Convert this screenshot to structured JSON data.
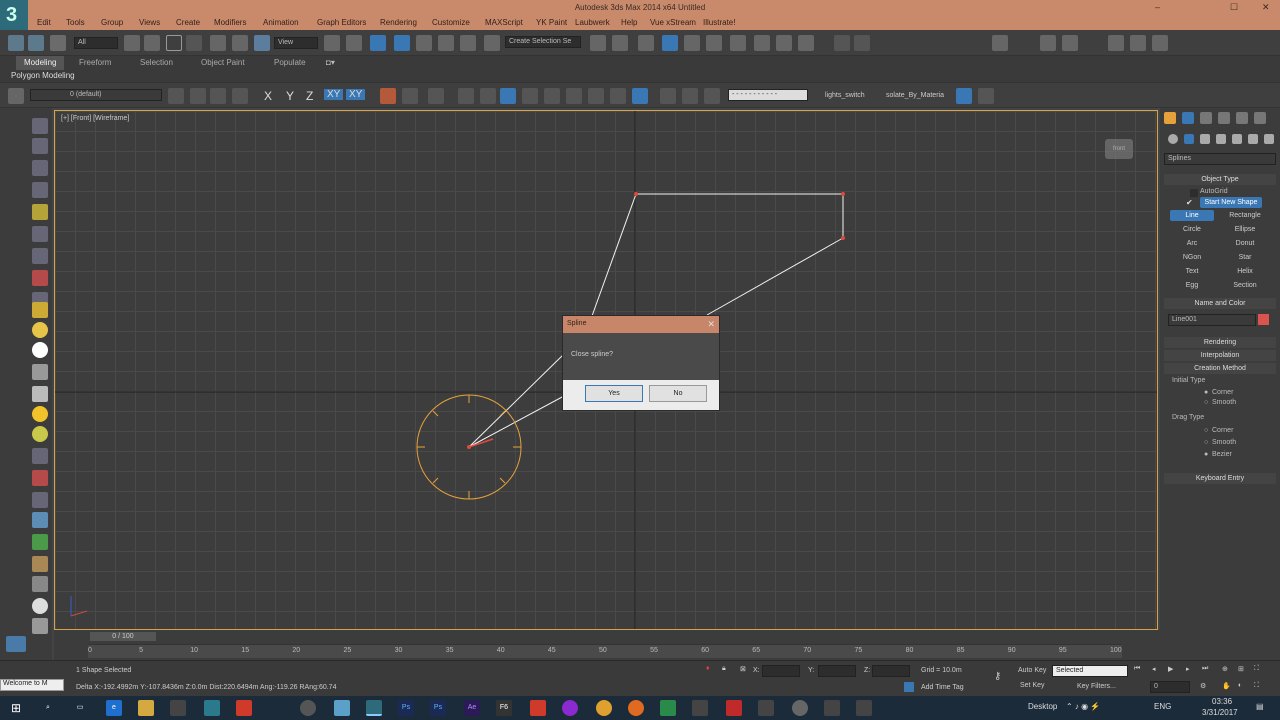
{
  "app": {
    "title": "Autodesk 3ds Max 2014 x64      Untitled"
  },
  "menu": [
    "Edit",
    "Tools",
    "Group",
    "Views",
    "Create",
    "Modifiers",
    "Animation",
    "Graph Editors",
    "Rendering",
    "Customize",
    "MAXScript",
    "YK Paint",
    "Laubwerk",
    "Help",
    "Vue xStream",
    "Illustrate!"
  ],
  "toolbar": {
    "filter": "All",
    "ref_coord": "View",
    "named_sel": "Create Selection Se"
  },
  "ribbon": {
    "tabs": [
      "Modeling",
      "Freeform",
      "Selection",
      "Object Paint",
      "Populate"
    ],
    "sub": "Polygon Modeling"
  },
  "toolbar2": {
    "layer": "0 (default)",
    "axes": [
      "X",
      "Y",
      "Z",
      "XY",
      "XY"
    ],
    "script1": "lights_switch",
    "script2": "solate_By_Materia"
  },
  "viewport": {
    "label": "[+] [Front] [Wireframe]",
    "gizmo": "front"
  },
  "dialog": {
    "title": "Spline",
    "message": "Close spline?",
    "yes": "Yes",
    "no": "No",
    "close": "✕"
  },
  "panel": {
    "category": "Splines",
    "object_type": "Object Type",
    "autogrid": "AutoGrid",
    "start_new_shape": "Start New Shape",
    "buttons": [
      [
        "Line",
        "Rectangle"
      ],
      [
        "Circle",
        "Ellipse"
      ],
      [
        "Arc",
        "Donut"
      ],
      [
        "NGon",
        "Star"
      ],
      [
        "Text",
        "Helix"
      ],
      [
        "Egg",
        "Section"
      ]
    ],
    "name_color": "Name and Color",
    "name": "Line001",
    "color": "#d9534f",
    "rendering": "Rendering",
    "interpolation": "Interpolation",
    "creation_method": "Creation Method",
    "initial_type": "Initial Type",
    "initial_opts": [
      "Corner",
      "Smooth"
    ],
    "drag_type": "Drag Type",
    "drag_opts": [
      "Corner",
      "Smooth",
      "Bezier"
    ],
    "keyboard_entry": "Keyboard Entry"
  },
  "timeline": {
    "frame": "0 / 100",
    "ticks": [
      "0",
      "5",
      "10",
      "15",
      "20",
      "25",
      "30",
      "35",
      "40",
      "45",
      "50",
      "55",
      "60",
      "65",
      "70",
      "75",
      "80",
      "85",
      "90",
      "95",
      "100"
    ]
  },
  "status": {
    "selected": "1 Shape Selected",
    "prompt": "Delta X:-192.4992m  Y:-107.8436m  Z:0.0m  Dist:220.6494m  Ang:-119.26  RAng:60.74",
    "welcome": "Welcome to M",
    "x": "X:",
    "y": "Y:",
    "z": "Z:",
    "grid": "Grid = 10.0m",
    "add_time_tag": "Add Time Tag",
    "auto_key": "Auto Key",
    "set_key": "Set Key",
    "selected_mode": "Selected",
    "key_filters": "Key Filters...",
    "frame": "0"
  },
  "taskbar": {
    "desktop": "Desktop",
    "lang": "ENG",
    "time": "03:36",
    "date": "3/31/2017"
  }
}
